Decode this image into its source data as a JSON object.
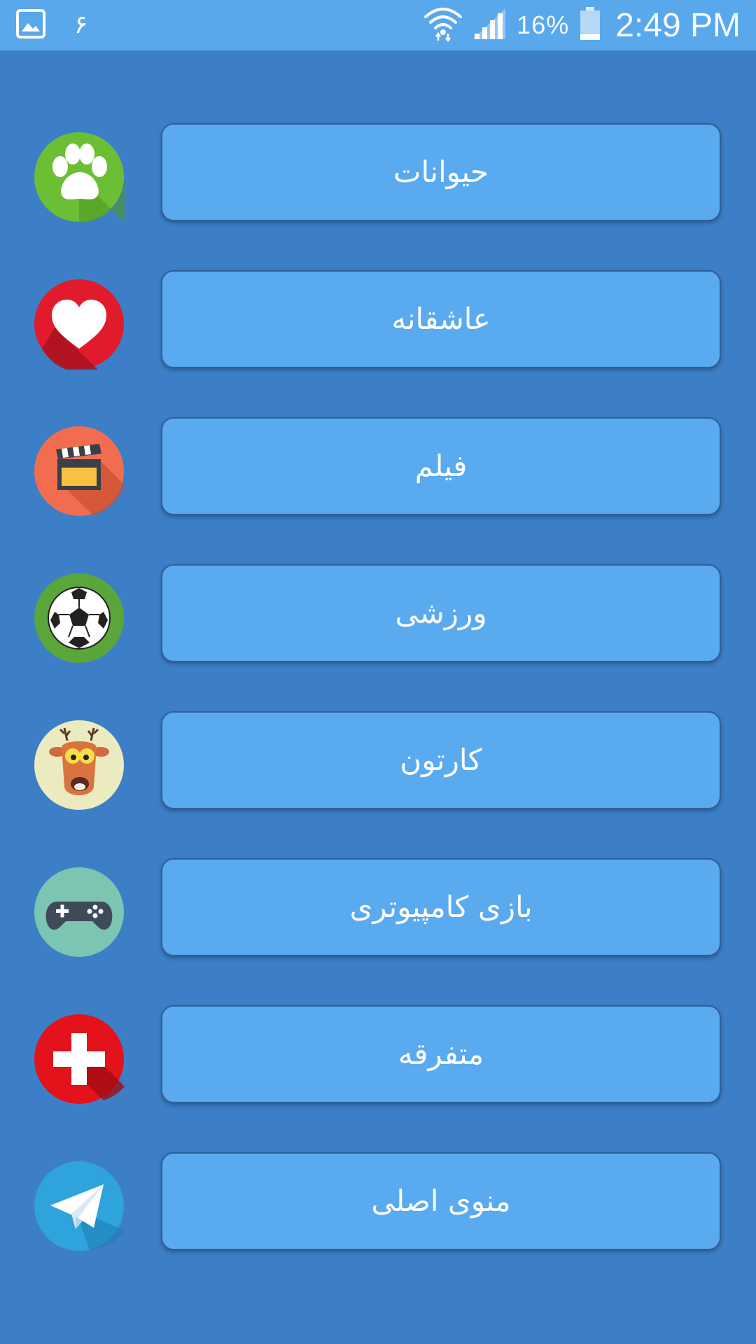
{
  "status_bar": {
    "left_digit": "۶",
    "battery_percent": "16%",
    "time": "2:49 PM",
    "icons": [
      "gallery-notification-icon",
      "wifi-icon",
      "cellular-signal-icon",
      "battery-icon"
    ]
  },
  "menu": {
    "items": [
      {
        "label": "حیوانات",
        "icon": "paw-icon"
      },
      {
        "label": "عاشقانه",
        "icon": "heart-icon"
      },
      {
        "label": "فیلم",
        "icon": "clapperboard-icon"
      },
      {
        "label": "ورزشی",
        "icon": "soccer-ball-icon"
      },
      {
        "label": "کارتون",
        "icon": "cartoon-deer-icon"
      },
      {
        "label": "بازی کامپیوتری",
        "icon": "gamepad-icon"
      },
      {
        "label": "متفرقه",
        "icon": "plus-cross-icon"
      },
      {
        "label": "منوی اصلی",
        "icon": "telegram-plane-icon"
      }
    ]
  },
  "colors": {
    "background": "#3d7fc6",
    "status_bar": "#5aa8ec",
    "button_fill": "#5aaaf0",
    "button_border": "#2f5f95",
    "text": "#ffffff"
  }
}
